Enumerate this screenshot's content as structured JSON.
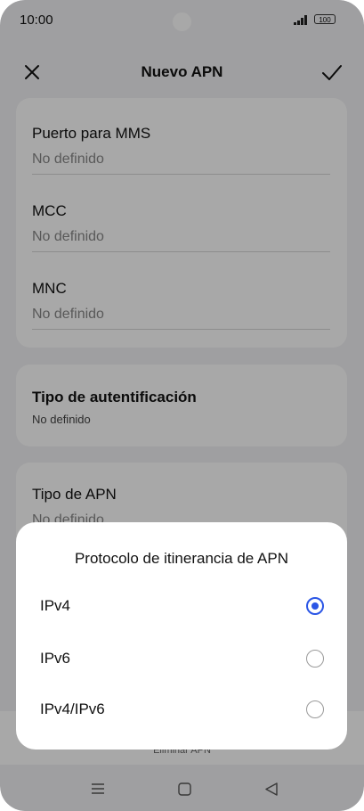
{
  "status_bar": {
    "time": "10:00",
    "battery": "100"
  },
  "app_bar": {
    "title": "Nuevo APN"
  },
  "fields": [
    {
      "label": "Puerto para MMS",
      "value": "No definido"
    },
    {
      "label": "MCC",
      "value": "No definido"
    },
    {
      "label": "MNC",
      "value": "No definido"
    }
  ],
  "auth": {
    "label": "Tipo de autentificación",
    "value": "No definido"
  },
  "apn_type": {
    "label": "Tipo de APN",
    "value": "No definido"
  },
  "bottom_action": {
    "label": "Eliminar APN"
  },
  "dialog": {
    "title": "Protocolo de itinerancia de APN",
    "options": [
      {
        "label": "IPv4",
        "selected": true
      },
      {
        "label": "IPv6",
        "selected": false
      },
      {
        "label": "IPv4/IPv6",
        "selected": false
      }
    ]
  },
  "colors": {
    "accent": "#2b56e6",
    "background": "#f2f2f4"
  }
}
